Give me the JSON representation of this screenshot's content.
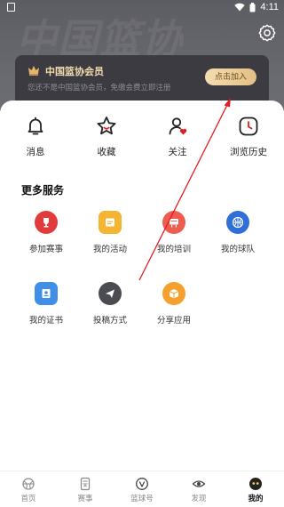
{
  "status_bar": {
    "time": "4:11"
  },
  "header": {
    "watermark": "中国篮协"
  },
  "vip": {
    "title": "中国篮协会员",
    "subtitle": "您还不是中国篮协会员，免缴会费立即注册",
    "join_label": "点击加入"
  },
  "quick_actions": [
    {
      "label": "消息",
      "icon": "bell-icon"
    },
    {
      "label": "收藏",
      "icon": "star-icon"
    },
    {
      "label": "关注",
      "icon": "user-heart-icon"
    },
    {
      "label": "浏览历史",
      "icon": "clock-icon"
    }
  ],
  "services": {
    "title": "更多服务",
    "items": [
      {
        "label": "参加赛事",
        "icon": "trophy-icon",
        "color": "#e23b3b"
      },
      {
        "label": "我的活动",
        "icon": "activity-icon",
        "color": "#f5b432"
      },
      {
        "label": "我的培训",
        "icon": "training-icon",
        "color": "#ee5b4f"
      },
      {
        "label": "我的球队",
        "icon": "basketball-icon",
        "color": "#2f6fd8"
      },
      {
        "label": "我的证书",
        "icon": "certificate-icon",
        "color": "#3f8fe6"
      },
      {
        "label": "投稿方式",
        "icon": "send-icon",
        "color": "#4b4b52"
      },
      {
        "label": "分享应用",
        "icon": "box-icon",
        "color": "#f5a02e"
      }
    ]
  },
  "bottom_nav": [
    {
      "label": "首页",
      "icon": "basketball-outline-icon"
    },
    {
      "label": "赛事",
      "icon": "scoreboard-icon"
    },
    {
      "label": "篮球号",
      "icon": "v-circle-icon"
    },
    {
      "label": "发现",
      "icon": "eye-icon"
    },
    {
      "label": "我的",
      "icon": "profile-face-icon"
    }
  ],
  "colors": {
    "header": "#67676e",
    "vip_card": "#3b3b41",
    "gold": "#e6c285",
    "annotation": "#e02020"
  }
}
